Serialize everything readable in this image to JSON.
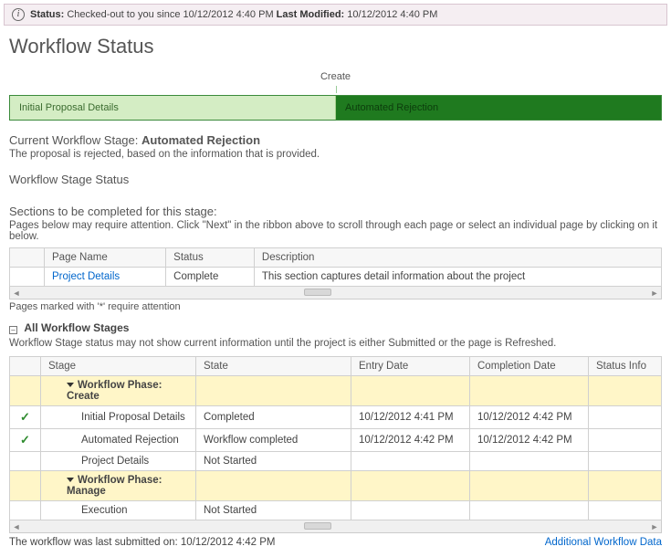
{
  "statusbar": {
    "status_label": "Status:",
    "status_text": "Checked-out to you since 10/12/2012 4:40 PM",
    "modified_label": "Last Modified:",
    "modified_text": "10/12/2012 4:40 PM"
  },
  "page_title": "Workflow Status",
  "phase_label": "Create",
  "stages_bar": {
    "left": "Initial Proposal Details",
    "right": "Automated Rejection"
  },
  "current_stage": {
    "prefix": "Current Workflow Stage:",
    "name": "Automated Rejection",
    "description": "The proposal is rejected, based on the information that is provided."
  },
  "stage_status_heading": "Workflow Stage Status",
  "sections_heading": "Sections to be completed for this stage:",
  "sections_hint": "Pages below may require attention. Click \"Next\" in the ribbon above to scroll through each page or select an individual page by clicking on it below.",
  "pages_table": {
    "headers": {
      "page": "Page Name",
      "status": "Status",
      "desc": "Description"
    },
    "rows": [
      {
        "page": "Project Details",
        "status": "Complete",
        "desc": "This section captures detail information about the project"
      }
    ]
  },
  "attention_note": "Pages marked with '*' require attention",
  "all_stages_heading": "All Workflow Stages",
  "all_stages_hint": "Workflow Stage status may not show current information until the project is either Submitted or the page is Refreshed.",
  "stages_table": {
    "headers": {
      "stage": "Stage",
      "state": "State",
      "entry": "Entry Date",
      "completion": "Completion Date",
      "info": "Status Info"
    },
    "phase1_label": "Workflow Phase: Create",
    "phase2_label": "Workflow Phase: Manage",
    "rows": {
      "r1": {
        "stage": "Initial Proposal Details",
        "state": "Completed",
        "entry": "10/12/2012 4:41 PM",
        "completion": "10/12/2012 4:42 PM",
        "info": ""
      },
      "r2": {
        "stage": "Automated Rejection",
        "state": "Workflow completed",
        "entry": "10/12/2012 4:42 PM",
        "completion": "10/12/2012 4:42 PM",
        "info": ""
      },
      "r3": {
        "stage": "Project Details",
        "state": "Not Started",
        "entry": "",
        "completion": "",
        "info": ""
      },
      "r4": {
        "stage": "Execution",
        "state": "Not Started",
        "entry": "",
        "completion": "",
        "info": ""
      }
    }
  },
  "footer": {
    "submitted": "The workflow was last submitted on: 10/12/2012 4:42 PM",
    "link": "Additional Workflow Data"
  }
}
